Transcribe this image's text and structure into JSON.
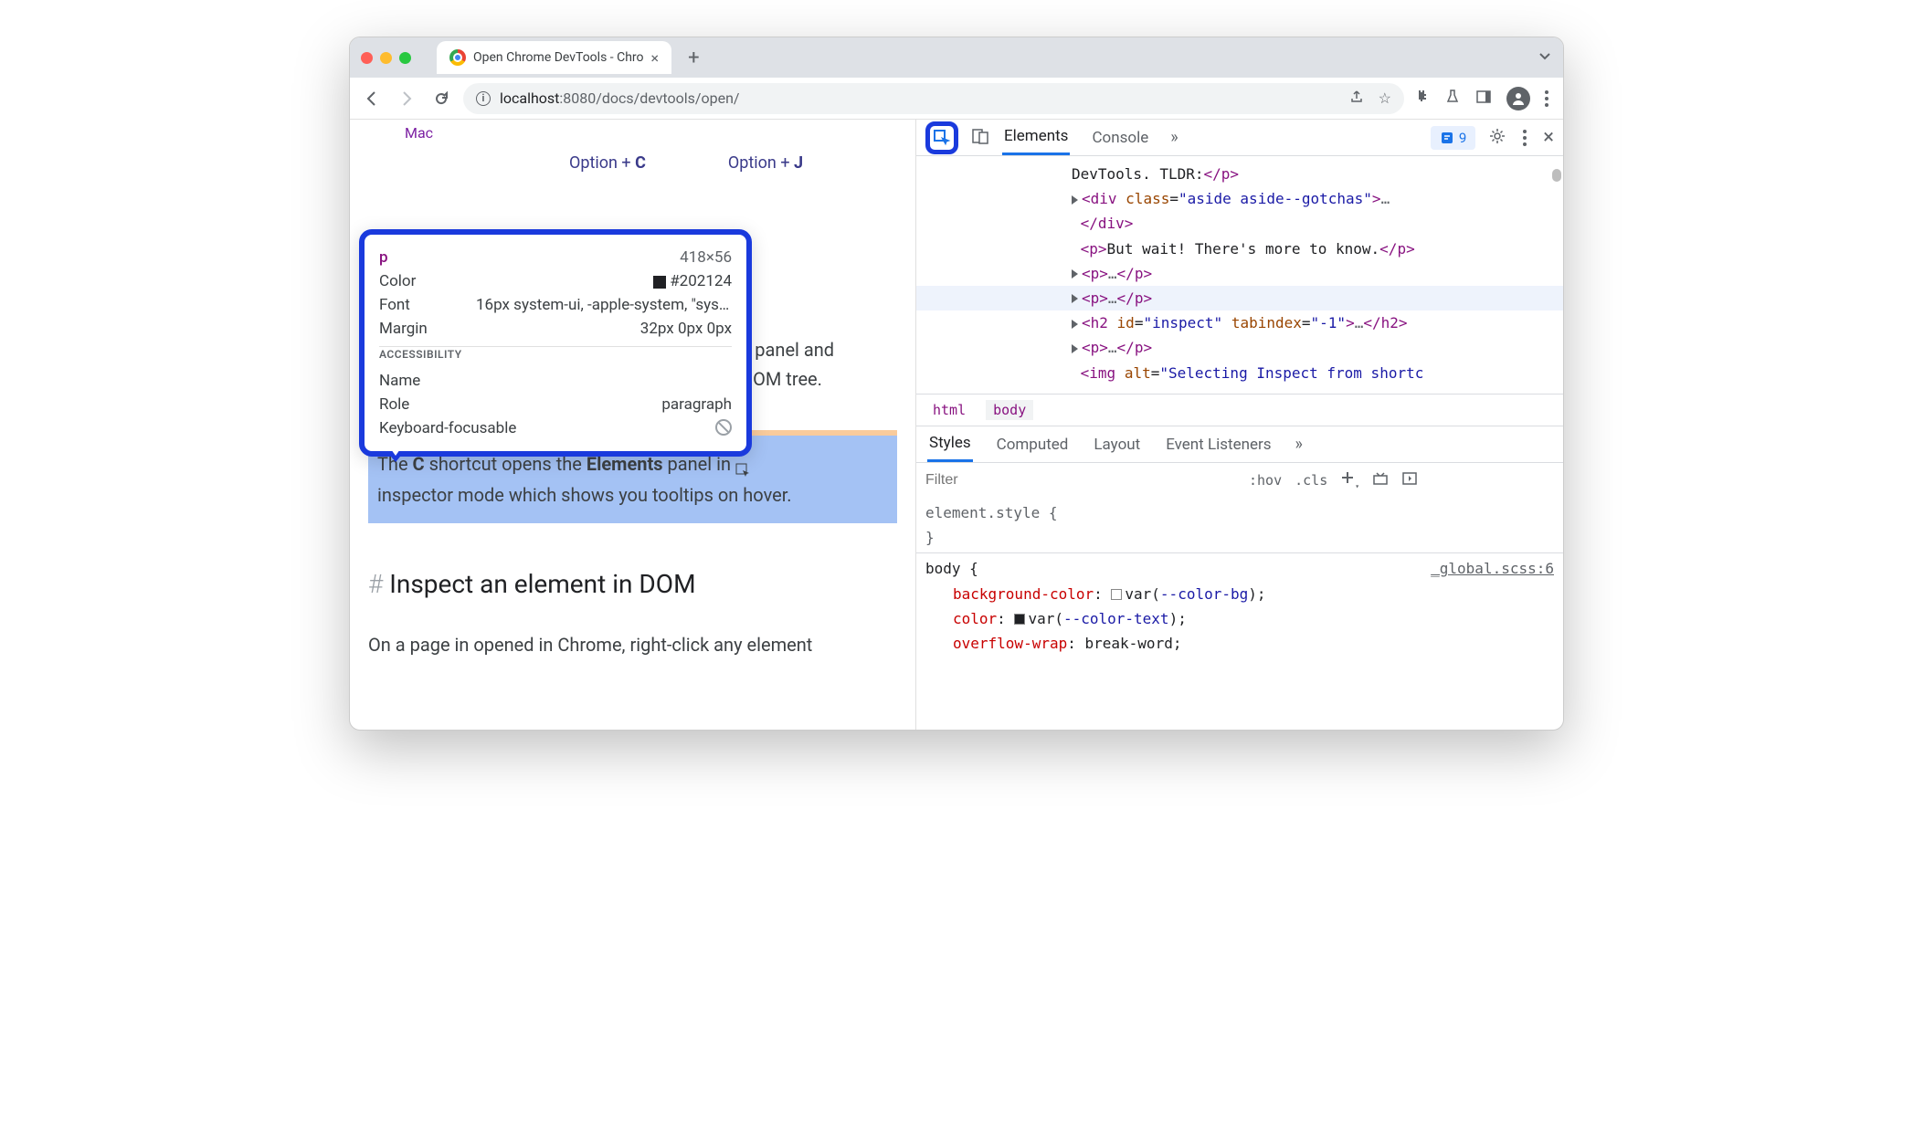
{
  "window": {
    "tab_title": "Open Chrome DevTools - Chro",
    "url_host": "localhost",
    "url_port": ":8080",
    "url_path": "/docs/devtools/open/"
  },
  "page": {
    "mac_label": "Mac",
    "shortcut_c_pre": "Option + ",
    "shortcut_c_key": "C",
    "shortcut_j_pre": "Option + ",
    "shortcut_j_key": "J",
    "hidden_tail1": "s panel and",
    "hidden_tail2": "DOM tree.",
    "blue_a": "The ",
    "blue_b": "C",
    "blue_c": " shortcut opens the ",
    "blue_d": "Elements",
    "blue_e": " panel in ",
    "blue_f": "inspector mode which shows you tooltips on hover.",
    "hash": "#",
    "h2": " Inspect an element in DOM",
    "body_p": "On a page in opened in Chrome, right-click any element"
  },
  "tooltip": {
    "tag": "p",
    "dim": "418×56",
    "color_lbl": "Color",
    "color_val": "#202124",
    "font_lbl": "Font",
    "font_val": "16px system-ui, -apple-system, \"syste…",
    "margin_lbl": "Margin",
    "margin_val": "32px 0px 0px",
    "acc_heading": "ACCESSIBILITY",
    "name_lbl": "Name",
    "role_lbl": "Role",
    "role_val": "paragraph",
    "kbd_lbl": "Keyboard-focusable"
  },
  "devtools": {
    "tab_elements": "Elements",
    "tab_console": "Console",
    "issues_count": "9",
    "breadcrumb_html": "html",
    "breadcrumb_body": "body",
    "styles_tab": "Styles",
    "computed_tab": "Computed",
    "layout_tab": "Layout",
    "listeners_tab": "Event Listeners",
    "filter_placeholder": "Filter",
    "hov": ":hov",
    "cls": ".cls"
  },
  "dom": {
    "l0": "DevTools. TLDR:",
    "div_class": "aside aside--gotchas",
    "p_text": "But wait! There's more to know.",
    "h2_id": "inspect",
    "h2_tabindex": "-1",
    "img_alt": "Selecting Inspect from shortc"
  },
  "styles": {
    "elstyle": "element.style {",
    "close": "}",
    "body_sel": "body {",
    "src": "_global.scss:6",
    "p1": "background-color",
    "v1": "var(",
    "v1var": "--color-bg",
    "p2": "color",
    "v2var": "--color-text",
    "p3": "overflow-wrap",
    "v3": "break-word"
  }
}
